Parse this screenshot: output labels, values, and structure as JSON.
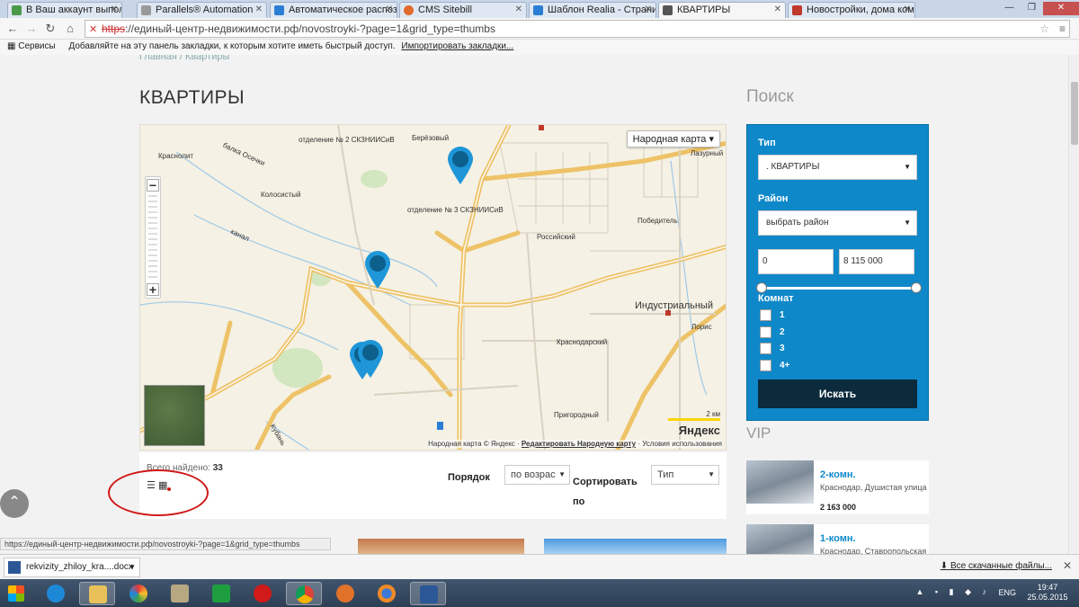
{
  "browser": {
    "tabs": [
      {
        "label": "В Ваш аккаунт выполнен",
        "fav": "#4a9a4a"
      },
      {
        "label": "Parallels® Automation",
        "fav": "#999999"
      },
      {
        "label": "Автоматическое распозн",
        "fav": "#2a7fd4"
      },
      {
        "label": "CMS Sitebill",
        "fav": "#e26a2c"
      },
      {
        "label": "Шаблон Realia - Страниц",
        "fav": "#2a7fd4"
      },
      {
        "label": "КВАРТИРЫ",
        "fav": "#555555"
      },
      {
        "label": "Новостройки, дома комп",
        "fav": "#c0392b"
      }
    ],
    "url_scheme": "https",
    "url_rest": "://единый-центр-недвижимости.рф/novostroyki-?page=1&grid_type=thumbs",
    "bookmarks": {
      "apps": "Сервисы",
      "hint": "Добавляйте на эту панель закладки, к которым хотите иметь быстрый доступ.",
      "import_link": "Импортировать закладки..."
    }
  },
  "page": {
    "breadcrumb": "Главная / Квартиры",
    "title": "КВАРТИРЫ",
    "map": {
      "type_button": "Народная карта",
      "labels": [
        {
          "text": "отделение № 2 СКЗНИИСиВ",
          "big": false
        },
        {
          "text": "Берёзовый",
          "big": false
        },
        {
          "text": "Краснолит",
          "big": false
        },
        {
          "text": "Колосистый",
          "big": false
        },
        {
          "text": "отделение № 3 СКЗНИИСиВ",
          "big": false
        },
        {
          "text": "Российский",
          "big": false
        },
        {
          "text": "Победитель",
          "big": false
        },
        {
          "text": "Лазурный",
          "big": false
        },
        {
          "text": "Индустриальный",
          "big": true
        },
        {
          "text": "Краснодарский",
          "big": false
        },
        {
          "text": "Лорис",
          "big": false
        },
        {
          "text": "Пригородный",
          "big": false
        },
        {
          "text": "балка Осечки",
          "big": false
        },
        {
          "text": "канал",
          "big": false
        },
        {
          "text": "Кубань",
          "big": false
        }
      ],
      "scale": "2 км",
      "brand": "Яндекс",
      "copyright_prefix": "Народная карта © Яндекс ·",
      "copyright_edit": "Редактировать Народную карту",
      "copyright_terms": "· Условия использования",
      "zoom_in": "+",
      "zoom_out": "−"
    },
    "results": {
      "found_label": "Всего найдено:",
      "found_count": "33",
      "order_label": "Порядок",
      "order_value": "по возрас",
      "sort_label": "Сортировать по",
      "sort_value": "Тип"
    }
  },
  "sidebar": {
    "search_title": "Поиск",
    "type_label": "Тип",
    "type_value": ". КВАРТИРЫ",
    "district_label": "Район",
    "district_value": "выбрать район",
    "price_min": "0",
    "price_max": "8 115 000",
    "rooms_label": "Комнат",
    "rooms": [
      "1",
      "2",
      "3",
      "4+"
    ],
    "search_button": "Искать",
    "vip_title": "VIP",
    "vip": [
      {
        "name": "2-комн.",
        "address": "Краснодар, Душистая улица",
        "price": "2 163 000"
      },
      {
        "name": "1-комн.",
        "address": "Краснодар, Ставропольская",
        "price": ""
      }
    ]
  },
  "status_link": "https://единый-центр-недвижимости.рф/novostroyki-?page=1&grid_type=thumbs",
  "downloads": {
    "file": "rekvizity_zhiloy_kra....docx",
    "all": "Все скачанные файлы..."
  },
  "taskbar": {
    "lang": "ENG",
    "time": "19:47",
    "date": "25.05.2015"
  },
  "colors": {
    "search_panel": "#0f88c9",
    "search_button": "#0b2a3c",
    "map_pin": "#1e96d8",
    "annotation": "#d01a1a"
  }
}
